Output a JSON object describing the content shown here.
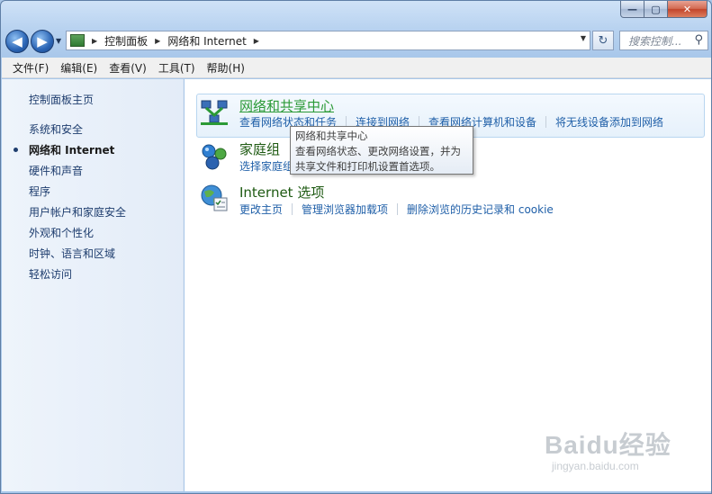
{
  "window": {
    "caption_min": "—",
    "caption_max": "▢",
    "caption_close": "✕"
  },
  "nav": {
    "back": "◀",
    "forward": "▶",
    "dropdown": "▼"
  },
  "address": {
    "crumbs": [
      "控制面板",
      "网络和 Internet"
    ],
    "separator": "▶",
    "dropdown": "▼",
    "refresh": "↻"
  },
  "search": {
    "placeholder": "搜索控制...",
    "icon": "⚲"
  },
  "menu": [
    "文件(F)",
    "编辑(E)",
    "查看(V)",
    "工具(T)",
    "帮助(H)"
  ],
  "sidebar": {
    "home": "控制面板主页",
    "items": [
      "系统和安全",
      "网络和 Internet",
      "硬件和声音",
      "程序",
      "用户帐户和家庭安全",
      "外观和个性化",
      "时钟、语言和区域",
      "轻松访问"
    ]
  },
  "categories": [
    {
      "title": "网络和共享中心",
      "icon": "network-sharing-center-icon",
      "tasks": [
        "查看网络状态和任务",
        "连接到网络",
        "查看网络计算机和设备",
        "将无线设备添加到网络"
      ]
    },
    {
      "title": "家庭组",
      "icon": "homegroup-icon",
      "tasks": [
        "选择家庭组"
      ]
    },
    {
      "title": "Internet 选项",
      "icon": "internet-options-icon",
      "tasks": [
        "更改主页",
        "管理浏览器加载项",
        "删除浏览的历史记录和 cookie"
      ]
    }
  ],
  "tooltip": {
    "title": "网络和共享中心",
    "body_line1": "查看网络状态、更改网络设置，并为",
    "body_line2": "共享文件和打印机设置首选项。"
  },
  "watermark": {
    "brand": "Baidu经验",
    "url": "jingyan.baidu.com"
  },
  "colors": {
    "link": "#1f5fa8",
    "category_title": "#1e5a12",
    "hover_title": "#2b9a36",
    "sidebar_bg": "#e3ecf8"
  }
}
